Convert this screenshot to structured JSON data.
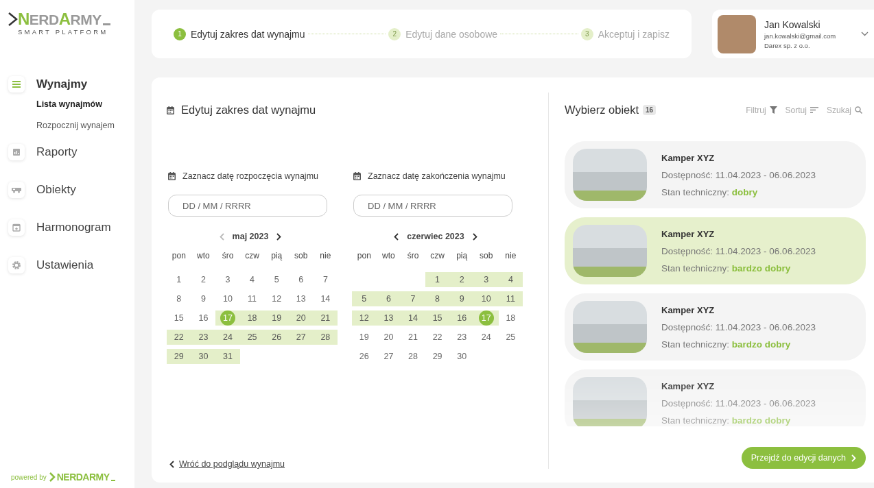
{
  "brand": {
    "logo_first": "N",
    "logo_rest1": "ERD",
    "logo_second": "A",
    "logo_rest2": "RMY",
    "tagline": "SMART PLATFORM"
  },
  "sidebar": {
    "items": [
      {
        "label": "Wynajmy",
        "kind": "menu",
        "selected": true,
        "expanded": true,
        "children": [
          {
            "label": "Lista wynajmów",
            "selected": true
          },
          {
            "label": "Rozpocznij wynajem",
            "selected": false
          }
        ]
      },
      {
        "label": "Raporty",
        "kind": "chart",
        "selected": false
      },
      {
        "label": "Obiekty",
        "kind": "camper",
        "selected": false
      },
      {
        "label": "Harmonogram",
        "kind": "calendar",
        "selected": false
      },
      {
        "label": "Ustawienia",
        "kind": "gear",
        "selected": false
      }
    ]
  },
  "powered_by": {
    "text": "powered by",
    "logo": "NERDARMY"
  },
  "stepper": [
    {
      "number": "1",
      "label": "Edytuj zakres dat wynajmu",
      "active": true
    },
    {
      "number": "2",
      "label": "Edytuj dane osobowe",
      "active": false
    },
    {
      "number": "3",
      "label": "Akceptuj i zapisz",
      "active": false
    }
  ],
  "user": {
    "name": "Jan Kowalski",
    "email": "jan.kowalski@gmail.com",
    "company": "Darex sp. z o.o."
  },
  "editor": {
    "title": "Edytuj zakres dat wynajmu",
    "back_link": "Wróć do podglądu wynajmu",
    "pickers": [
      {
        "label": "Zaznacz datę rozpoczęcia wynajmu",
        "placeholder": "DD / MM / RRRR",
        "month": "maj 2023",
        "prev_disabled": true,
        "weekdays": [
          "pon",
          "wto",
          "śro",
          "czw",
          "pią",
          "sob",
          "nie"
        ],
        "weeks": [
          [
            {
              "day": "1",
              "in_range": false,
              "selected": false
            },
            {
              "day": "2",
              "in_range": false,
              "selected": false
            },
            {
              "day": "3",
              "in_range": false,
              "selected": false
            },
            {
              "day": "4",
              "in_range": false,
              "selected": false
            },
            {
              "day": "5",
              "in_range": false,
              "selected": false
            },
            {
              "day": "6",
              "in_range": false,
              "selected": false
            },
            {
              "day": "7",
              "in_range": false,
              "selected": false
            }
          ],
          [
            {
              "day": "8",
              "in_range": false,
              "selected": false
            },
            {
              "day": "9",
              "in_range": false,
              "selected": false
            },
            {
              "day": "10",
              "in_range": false,
              "selected": false
            },
            {
              "day": "11",
              "in_range": false,
              "selected": false
            },
            {
              "day": "12",
              "in_range": false,
              "selected": false
            },
            {
              "day": "13",
              "in_range": false,
              "selected": false
            },
            {
              "day": "14",
              "in_range": false,
              "selected": false
            }
          ],
          [
            {
              "day": "15",
              "in_range": false,
              "selected": false
            },
            {
              "day": "16",
              "in_range": false,
              "selected": false
            },
            {
              "day": "17",
              "in_range": true,
              "selected": true
            },
            {
              "day": "18",
              "in_range": true,
              "selected": false
            },
            {
              "day": "19",
              "in_range": true,
              "selected": false
            },
            {
              "day": "20",
              "in_range": true,
              "selected": false
            },
            {
              "day": "21",
              "in_range": true,
              "selected": false
            }
          ],
          [
            {
              "day": "22",
              "in_range": true,
              "selected": false
            },
            {
              "day": "23",
              "in_range": true,
              "selected": false
            },
            {
              "day": "24",
              "in_range": true,
              "selected": false
            },
            {
              "day": "25",
              "in_range": true,
              "selected": false
            },
            {
              "day": "26",
              "in_range": true,
              "selected": false
            },
            {
              "day": "27",
              "in_range": true,
              "selected": false
            },
            {
              "day": "28",
              "in_range": true,
              "selected": false
            }
          ],
          [
            {
              "day": "29",
              "in_range": true,
              "selected": false
            },
            {
              "day": "30",
              "in_range": true,
              "selected": false
            },
            {
              "day": "31",
              "in_range": true,
              "selected": false
            }
          ]
        ]
      },
      {
        "label": "Zaznacz datę zakończenia wynajmu",
        "placeholder": "DD / MM / RRRR",
        "month": "czerwiec 2023",
        "prev_disabled": false,
        "weekdays": [
          "pon",
          "wto",
          "śro",
          "czw",
          "pią",
          "sob",
          "nie"
        ],
        "weeks": [
          [
            {
              "day": "1",
              "in_range": true,
              "selected": false
            },
            {
              "day": "2",
              "in_range": true,
              "selected": false
            },
            {
              "day": "3",
              "in_range": true,
              "selected": false
            },
            {
              "day": "4",
              "in_range": true,
              "selected": false
            }
          ],
          [
            {
              "day": "5",
              "in_range": true,
              "selected": false
            },
            {
              "day": "6",
              "in_range": true,
              "selected": false
            },
            {
              "day": "7",
              "in_range": true,
              "selected": false
            },
            {
              "day": "8",
              "in_range": true,
              "selected": false
            },
            {
              "day": "9",
              "in_range": true,
              "selected": false
            },
            {
              "day": "10",
              "in_range": true,
              "selected": false
            },
            {
              "day": "11",
              "in_range": true,
              "selected": false
            }
          ],
          [
            {
              "day": "12",
              "in_range": true,
              "selected": false
            },
            {
              "day": "13",
              "in_range": true,
              "selected": false
            },
            {
              "day": "14",
              "in_range": true,
              "selected": false
            },
            {
              "day": "15",
              "in_range": true,
              "selected": false
            },
            {
              "day": "16",
              "in_range": true,
              "selected": false
            },
            {
              "day": "17",
              "in_range": true,
              "selected": true
            },
            {
              "day": "18",
              "in_range": false,
              "selected": false
            }
          ],
          [
            {
              "day": "19",
              "in_range": false,
              "selected": false
            },
            {
              "day": "20",
              "in_range": false,
              "selected": false
            },
            {
              "day": "21",
              "in_range": false,
              "selected": false
            },
            {
              "day": "22",
              "in_range": false,
              "selected": false
            },
            {
              "day": "23",
              "in_range": false,
              "selected": false
            },
            {
              "day": "24",
              "in_range": false,
              "selected": false
            },
            {
              "day": "25",
              "in_range": false,
              "selected": false
            }
          ],
          [
            {
              "day": "26",
              "in_range": false,
              "selected": false
            },
            {
              "day": "27",
              "in_range": false,
              "selected": false
            },
            {
              "day": "28",
              "in_range": false,
              "selected": false
            },
            {
              "day": "29",
              "in_range": false,
              "selected": false
            },
            {
              "day": "30",
              "in_range": false,
              "selected": false
            }
          ]
        ]
      }
    ]
  },
  "objects": {
    "title": "Wybierz obiekt",
    "count": "16",
    "tools": [
      {
        "label": "Filtruj",
        "kind": "filter"
      },
      {
        "label": "Sortuj",
        "kind": "sort"
      },
      {
        "label": "Szukaj",
        "kind": "search"
      }
    ],
    "items": [
      {
        "name": "Kamper XYZ",
        "availability": "Dostępność: 11.04.2023 - 06.06.2023",
        "condition_label": "Stan techniczny:",
        "condition": "dobry",
        "selected": false
      },
      {
        "name": "Kamper XYZ",
        "availability": "Dostępność: 11.04.2023 - 06.06.2023",
        "condition_label": "Stan techniczny:",
        "condition": "bardzo dobry",
        "selected": true
      },
      {
        "name": "Kamper XYZ",
        "availability": "Dostępność: 11.04.2023 - 06.06.2023",
        "condition_label": "Stan techniczny:",
        "condition": "bardzo dobry",
        "selected": false
      },
      {
        "name": "Kamper XYZ",
        "availability": "Dostępność: 11.04.2023 - 06.06.2023",
        "condition_label": "Stan techniczny:",
        "condition": "bardzo dobry",
        "selected": false
      }
    ],
    "next_button": "Przejdź do edycji danych"
  }
}
